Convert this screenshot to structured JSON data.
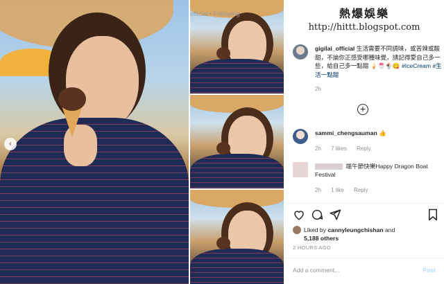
{
  "header": {
    "username_partial": "official",
    "following_label": "• Following"
  },
  "watermark": {
    "title": "熱爆娛樂",
    "url": "http://hittt.blogspot.com"
  },
  "carousel": {
    "prev_glyph": "‹"
  },
  "caption": {
    "username": "gigilai_official",
    "text": "生活需要不同調味，或苦辣或酸甜，不論你正感受哪種味覺，請記得愛自己多一些，給自己多一點甜",
    "emojis": "🍦🍧🍨😋",
    "hashtags": "#IceCream #生活一點甜",
    "time": "2h"
  },
  "load_more_glyph": "+",
  "comments": [
    {
      "username": "sammi_chengsauman",
      "text": "👍",
      "time": "2h",
      "likes": "7 likes",
      "reply": "Reply"
    },
    {
      "username": "",
      "text": "端午節快樂Happy Dragon Boat Festival",
      "time": "2h",
      "likes": "1 like",
      "reply": "Reply"
    }
  ],
  "likes": {
    "prefix": "Liked by ",
    "user": "cannyleungchishan",
    "suffix": " and",
    "count": "5,188 others"
  },
  "posted_ago": "2 HOURS AGO",
  "composer": {
    "placeholder": "Add a comment...",
    "post_label": "Post"
  },
  "icons": [
    "heart-icon",
    "comment-icon",
    "share-icon",
    "bookmark-icon"
  ]
}
